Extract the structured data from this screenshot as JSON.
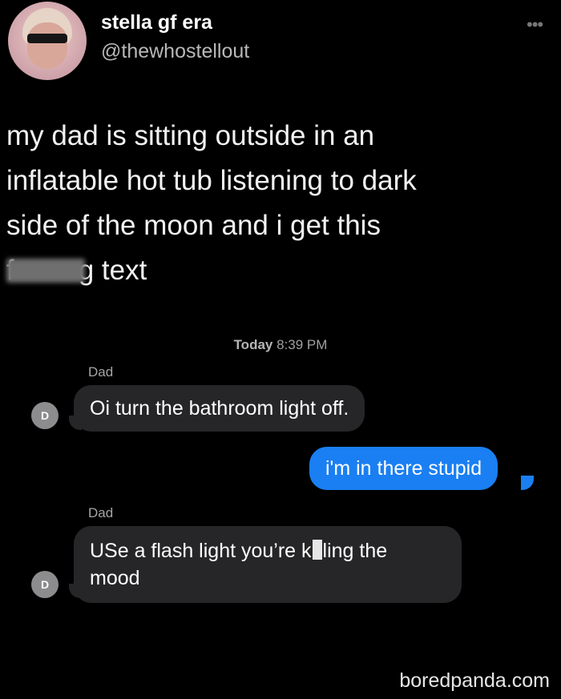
{
  "profile": {
    "display_name": "stella gf era",
    "handle": "@thewhostellout",
    "more_icon": "ellipsis-icon"
  },
  "tweet": {
    "line1": "my dad is sitting outside in an",
    "line2": "inflatable hot tub listening to dark",
    "line3": "side of the moon and i get this",
    "line4_start": "f",
    "line4_end": "g text"
  },
  "messages": {
    "timestamp_day": "Today",
    "timestamp_time": "8:39 PM",
    "items": [
      {
        "sender": "Dad",
        "avatar_initial": "D",
        "text": "Oi turn the bathroom light off."
      },
      {
        "text": "i'm in there stupid"
      },
      {
        "sender": "Dad",
        "avatar_initial": "D",
        "text_start": "USe a flash light you’re k",
        "text_end": "ling the",
        "text_line2": "mood"
      }
    ]
  },
  "watermark": "boredpanda.com",
  "colors": {
    "background": "#000000",
    "incoming_bubble": "#262628",
    "outgoing_bubble": "#1a7ff2"
  }
}
